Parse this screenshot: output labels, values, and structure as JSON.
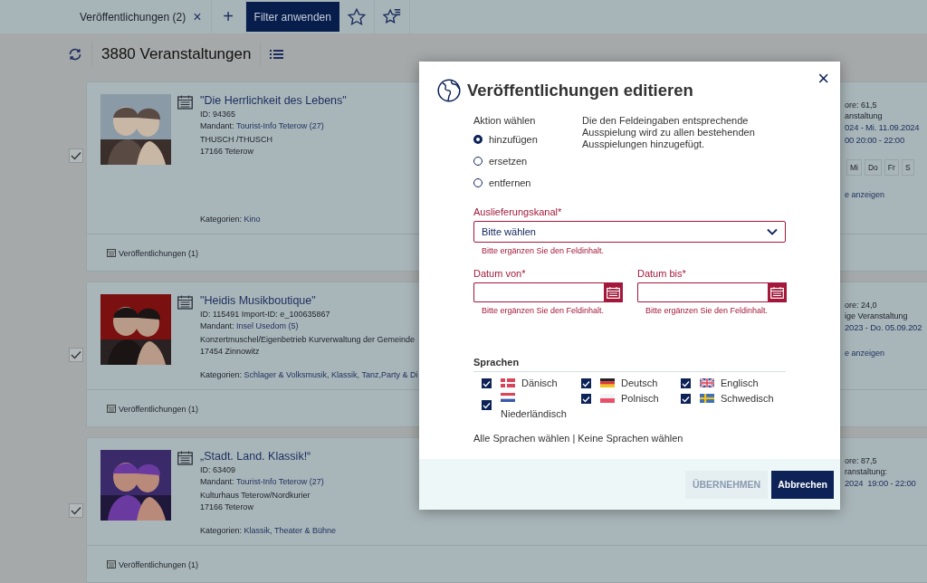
{
  "tabs": [
    {
      "label": "Veröffentlichungen (2)",
      "close": "×",
      "selected": true
    }
  ],
  "add_tab": "+",
  "filter_button": "Filter anwenden",
  "heading": "3880 Veranstaltungen",
  "events": [
    {
      "checked": true,
      "title": "\"Die Herrlichkeit des Lebens\"",
      "id_line": "ID: 94365",
      "mandant_label": "Mandant:",
      "mandant": "Tourist-Info Teterow (27)",
      "venue": "THUSCH /THUSCH",
      "city": "17166 Teterow",
      "categories_label": "Kategorien:",
      "categories": "Kino",
      "footer": "Veröffentlichungen (1)",
      "right": {
        "score": "ore: 61,5",
        "type": "anstaltung",
        "dates": "024 - Mi. 11.09.2024",
        "times": "00 20:00 - 22:00",
        "days": [
          "Mi",
          "Do",
          "Fr",
          "S"
        ],
        "link": "e anzeigen"
      }
    },
    {
      "checked": true,
      "title": "\"Heidis Musikboutique\"",
      "id_line": "ID: 115491 Import-ID: e_100635867",
      "mandant_label": "Mandant:",
      "mandant": "Insel Usedom (5)",
      "venue": "Konzertmuschel/Eigenbetrieb Kurverwaltung der Gemeinde",
      "city": "17454 Zinnowitz",
      "categories_label": "Kategorien:",
      "categories": "Schlager & Volksmusik, Klassik, Tanz,Party & Di",
      "footer": "Veröffentlichungen (1)",
      "right": {
        "score": "ore: 24,0",
        "type": "ige Veranstaltung",
        "dates": "2023 - Do. 05.09.202",
        "link": "e anzeigen"
      }
    },
    {
      "checked": true,
      "title": "„Stadt. Land. Klassik!“",
      "id_line": "ID: 63409",
      "mandant_label": "Mandant:",
      "mandant": "Tourist-Info Teterow (27)",
      "venue": "Kulturhaus Teterow/Nordkurier",
      "city": "17166 Teterow",
      "categories_label": "Kategorien:",
      "categories": "Klassik, Theater & Bühne",
      "footer": "Veröffentlichungen (1)",
      "right": {
        "score": "ore: 87,5",
        "type": "ranstaltung:",
        "dates": "2024  19:00 - 22:00"
      }
    }
  ],
  "dialog": {
    "title": "Veröffentlichungen editieren",
    "close": "×",
    "action_label": "Aktion wählen",
    "actions": [
      {
        "label": "hinzufügen",
        "selected": true
      },
      {
        "label": "ersetzen",
        "selected": false
      },
      {
        "label": "entfernen",
        "selected": false
      }
    ],
    "description": "Die den Feldeingaben entsprechende Ausspielung wird zu allen bestehenden Ausspielungen hinzugefügt.",
    "channel": {
      "label": "Auslieferungskanal*",
      "value": "Bitte wählen",
      "error": "Bitte ergänzen Sie den Feldinhalt."
    },
    "date_from": {
      "label": "Datum von*",
      "error": "Bitte ergänzen Sie den Feldinhalt."
    },
    "date_to": {
      "label": "Datum bis*",
      "error": "Bitte ergänzen Sie den Feldinhalt."
    },
    "languages_label": "Sprachen",
    "languages": [
      {
        "label": "Dänisch",
        "checked": true
      },
      {
        "label": "Deutsch",
        "checked": true
      },
      {
        "label": "Englisch",
        "checked": true
      },
      {
        "label": "Niederländisch",
        "checked": true
      },
      {
        "label": "Polnisch",
        "checked": true
      },
      {
        "label": "Schwedisch",
        "checked": true
      }
    ],
    "select_all": "Alle Sprachen wählen",
    "separator": "|",
    "select_none": "Keine Sprachen wählen",
    "apply_button": {
      "label": "ÜBERNEHMEN",
      "disabled": true
    },
    "cancel_button": "Abbrechen"
  }
}
